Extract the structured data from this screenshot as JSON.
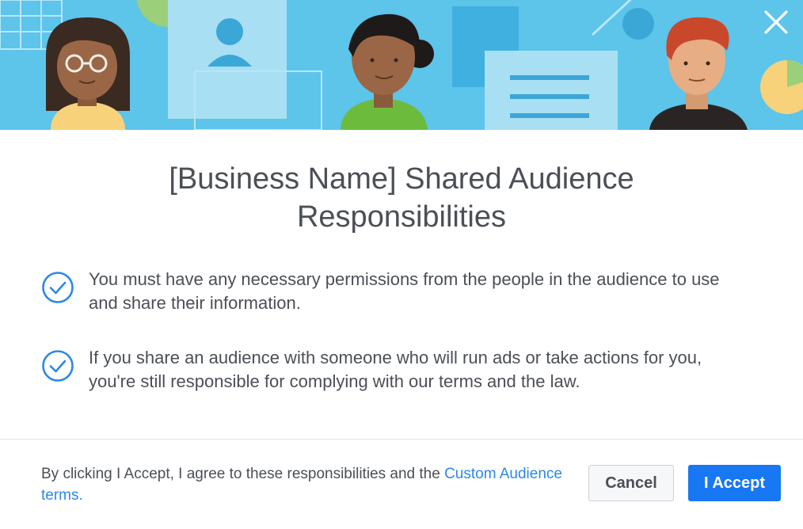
{
  "dialog": {
    "title_line1": "[Business Name] Shared Audience",
    "title_line2": "Responsibilities",
    "responsibilities": [
      {
        "line1": "You must have any necessary permissions from the people in the audience to use",
        "line2": "and share their information."
      },
      {
        "line1": "If you share an audience with someone who will run ads or take actions for you,",
        "line2": "you're still responsible for complying with our terms and the law."
      }
    ],
    "footer": {
      "text_before_link": "By clicking I Accept, I agree to these responsibilities and the ",
      "link_text": "Custom Audience terms."
    },
    "buttons": {
      "cancel_label": "Cancel",
      "accept_label": "I Accept"
    }
  },
  "icons": {
    "close": "close-icon",
    "check": "check-circle-icon"
  },
  "colors": {
    "banner_bg": "#5dc4ea",
    "check_blue": "#2d88e6",
    "link_blue": "#2d88e6",
    "accept_bg": "#1877f2",
    "text": "#4b4f56"
  }
}
